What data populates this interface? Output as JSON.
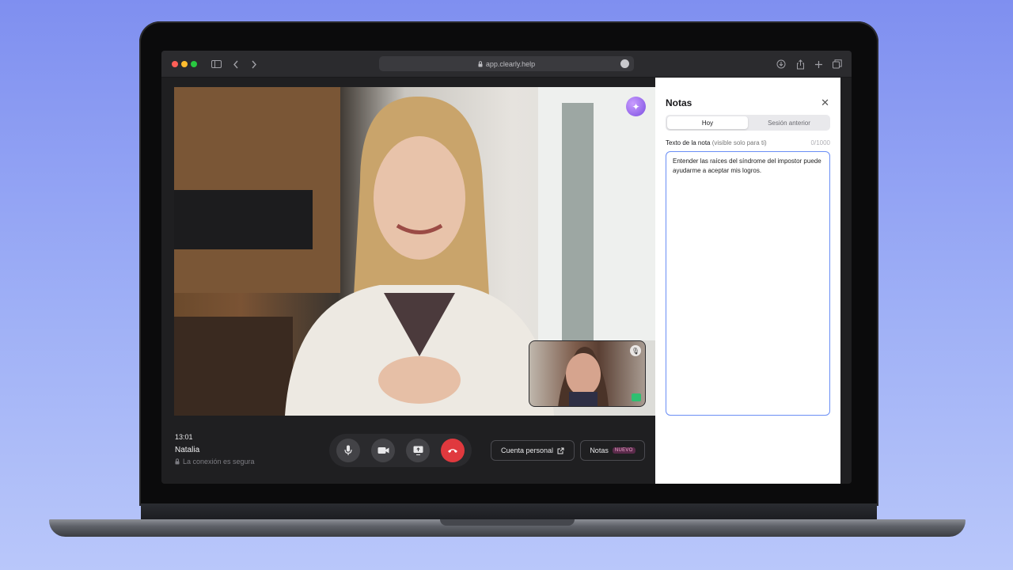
{
  "browser": {
    "url": "app.clearly.help",
    "traffic_lights": [
      "#ff5f57",
      "#febc2e",
      "#28c840"
    ]
  },
  "call": {
    "time": "13:01",
    "participant_name": "Natalia",
    "secure_text": "La conexión es segura",
    "personal_account_label": "Cuenta personal",
    "notes_button_label": "Notas",
    "new_badge": "NUEVO",
    "controls": [
      "mic-icon",
      "camera-icon",
      "share-screen-icon",
      "end-call-icon"
    ]
  },
  "notes": {
    "title": "Notas",
    "tabs": [
      {
        "label": "Hoy",
        "active": true
      },
      {
        "label": "Sesión anterior",
        "active": false
      }
    ],
    "field_label": "Texto de la nota",
    "field_hint": "(visible solo para ti)",
    "counter": "0/1000",
    "text": "Entender las raíces del síndrome del impostor puede ayudarme a aceptar mis logros."
  },
  "colors": {
    "accent": "#6a8ef5",
    "end_call": "#e0393e",
    "ai_button": "#8b5cf6",
    "badge_bg": "#5a2a4a",
    "badge_text": "#f1a7cf"
  }
}
